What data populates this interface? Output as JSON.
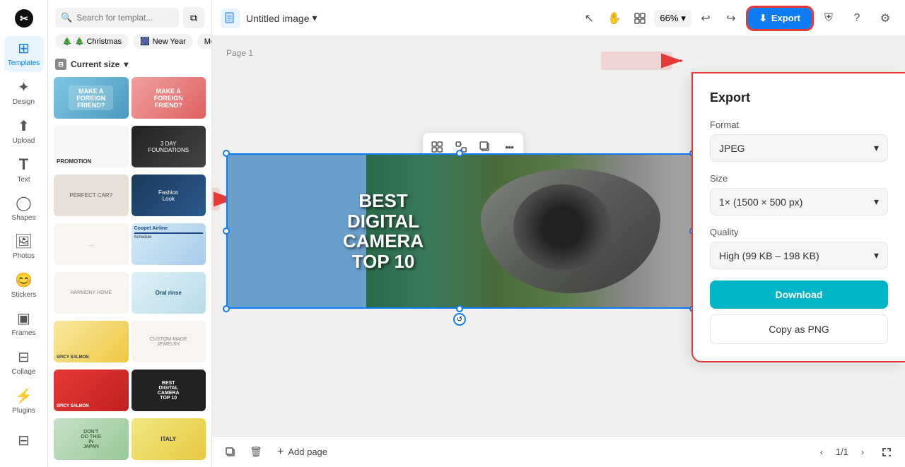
{
  "app": {
    "logo": "✂",
    "title": "Untitled image",
    "title_chevron": "▾"
  },
  "sidebar": {
    "items": [
      {
        "id": "templates",
        "label": "Templates",
        "icon": "⊞",
        "active": true
      },
      {
        "id": "design",
        "label": "Design",
        "icon": "✦"
      },
      {
        "id": "upload",
        "label": "Upload",
        "icon": "↑"
      },
      {
        "id": "text",
        "label": "Text",
        "icon": "T"
      },
      {
        "id": "shapes",
        "label": "Shapes",
        "icon": "◯"
      },
      {
        "id": "photos",
        "label": "Photos",
        "icon": "🖼"
      },
      {
        "id": "stickers",
        "label": "Stickers",
        "icon": "😊"
      },
      {
        "id": "frames",
        "label": "Frames",
        "icon": "▣"
      },
      {
        "id": "collage",
        "label": "Collage",
        "icon": "⊟"
      },
      {
        "id": "plugins",
        "label": "Plugins",
        "icon": "⚡"
      }
    ],
    "bottom_icon": "⊟"
  },
  "panel": {
    "search_placeholder": "Search for templat...",
    "filter_icon": "⧉",
    "tags": [
      {
        "label": "🎄 Christmas"
      },
      {
        "label": "🎆 New Year"
      },
      {
        "label": "Mo..."
      }
    ],
    "current_size": {
      "label": "Current size",
      "chevron": "▾"
    }
  },
  "topbar": {
    "doc_title": "Untitled image",
    "zoom": "66%",
    "tools": {
      "select": "↖",
      "hand": "✋",
      "layout": "⊞",
      "zoom_chevron": "▾",
      "undo": "↩",
      "redo": "↪"
    },
    "export_label": "Export",
    "export_icon": "⬇",
    "shield_icon": "⛨",
    "question_icon": "?",
    "settings_icon": "⚙"
  },
  "canvas": {
    "page_label": "Page 1",
    "canvas_text": "BEST\nDIGITAL\nCAMERA\nTOP 10"
  },
  "float_toolbar": {
    "icon1": "⊞",
    "icon2": "⊡",
    "icon3": "⊟",
    "more": "•••"
  },
  "bottombar": {
    "copy_icon": "⊟",
    "delete_icon": "🗑",
    "add_page_label": "Add page",
    "page_nav": "1/1"
  },
  "export_panel": {
    "title": "Export",
    "format_label": "Format",
    "format_value": "JPEG",
    "size_label": "Size",
    "size_value": "1× (1500 × 500 px)",
    "quality_label": "Quality",
    "quality_value": "High (99 KB – 198 KB)",
    "download_label": "Download",
    "copy_png_label": "Copy as PNG"
  },
  "colors": {
    "accent_blue": "#0d7cf2",
    "accent_cyan": "#00b5c8",
    "red_annotation": "#e53935"
  }
}
